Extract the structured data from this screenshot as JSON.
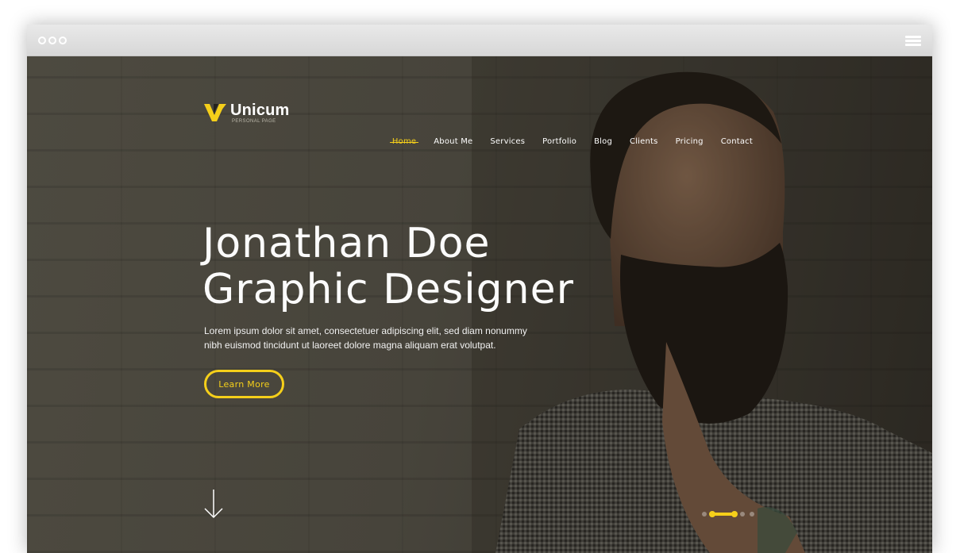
{
  "browser": {
    "controls_icon": "window-dots-icon",
    "menu_icon": "hamburger-menu-icon"
  },
  "brand": {
    "name": "Unicum",
    "tagline": "PERSONAL PAGE",
    "accent_color": "#f5cf1a"
  },
  "nav": {
    "items": [
      {
        "label": "Home",
        "active": true
      },
      {
        "label": "About Me",
        "active": false
      },
      {
        "label": "Services",
        "active": false
      },
      {
        "label": "Portfolio",
        "active": false
      },
      {
        "label": "Blog",
        "active": false
      },
      {
        "label": "Clients",
        "active": false
      },
      {
        "label": "Pricing",
        "active": false
      },
      {
        "label": "Contact",
        "active": false
      }
    ]
  },
  "hero": {
    "title_line1": "Jonathan Doe",
    "title_line2": "Graphic Designer",
    "intro": "Lorem ipsum dolor sit amet, consectetuer adipiscing elit, sed diam nonummy nibh euismod tincidunt ut laoreet dolore magna aliquam erat volutpat.",
    "cta_label": "Learn More",
    "scroll_icon": "arrow-down-icon"
  },
  "slider": {
    "total": 5,
    "active_index": 1
  }
}
